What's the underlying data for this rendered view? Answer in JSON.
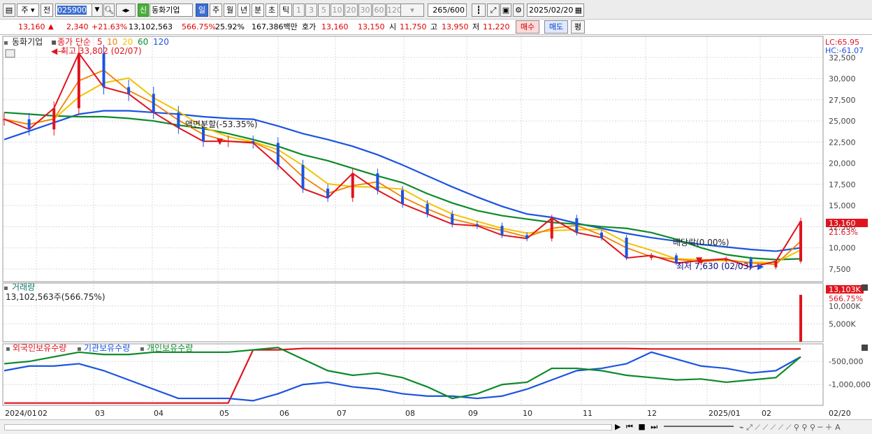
{
  "toolbar": {
    "period_select": "주",
    "jeon_button": "전",
    "code_value": "025900",
    "new_badge": "신",
    "stock_name": "동화기업",
    "period_tabs": [
      "일",
      "주",
      "월",
      "년",
      "분",
      "초",
      "틱"
    ],
    "interval_buttons": [
      "1",
      "3",
      "5",
      "10",
      "20",
      "30",
      "60",
      "120"
    ],
    "count_display": "265",
    "count_total": "/600",
    "date_value": "2025/02/20"
  },
  "quote": {
    "price": "13,160",
    "change": "2,340",
    "change_pct": "+21.63%",
    "volume": "13,102,563",
    "volume_ratio": "566.75%",
    "turnover": "25.92%",
    "amount": "167,386백만",
    "ask_label": "호가",
    "ask_price": "13,160",
    "bid_price": "13,150",
    "open_label": "시",
    "open": "11,750",
    "high_label": "고",
    "high": "13,950",
    "low_label": "저",
    "low": "11,220",
    "buy_button": "매수",
    "sell_button": "매도",
    "eval_button": "평"
  },
  "price_pane": {
    "title": "동화기업",
    "legend_prefix": "종가 단순",
    "ma_periods": [
      "5",
      "10",
      "20",
      "60",
      "120"
    ],
    "ma_colors": [
      "#e0141e",
      "#f18000",
      "#f3c200",
      "#0e8a2a",
      "#1c54e0"
    ],
    "high_note": "최고 33,802 (02/07)",
    "low_note": "최저 7,630 (02/03)",
    "split_note": "액면분할(-53.35%)",
    "dividend_note": "배당락(0.00%)",
    "lc_label": "LC:65.95",
    "hc_label": "HC:-61.07",
    "current_price_label": "13,160",
    "current_pct_label": "21.63%"
  },
  "volume_pane": {
    "title": "거래량",
    "value_text": "13,102,563주(566.75%)",
    "current_label": "13,103K",
    "current_pct": "566.75%",
    "y_ticks": [
      "5,000K",
      "10,000K"
    ]
  },
  "holding_pane": {
    "legend": [
      "외국인보유수량",
      "기관보유수량",
      "개인보유수량"
    ],
    "legend_colors": [
      "#e0141e",
      "#1c54e0",
      "#0e8a2a"
    ],
    "y_ticks": [
      "-500,000",
      "-1,000,000"
    ]
  },
  "x_axis": [
    "2024/01",
    "02",
    "03",
    "04",
    "05",
    "06",
    "07",
    "08",
    "09",
    "10",
    "11",
    "12",
    "2025/01",
    "02"
  ],
  "right_axis_end_label": "02/20",
  "chart_data": {
    "type": "line",
    "title": "동화기업",
    "price_y_ticks": [
      7500,
      10000,
      12500,
      15000,
      17500,
      20000,
      22500,
      25000,
      27500,
      30000,
      32500
    ],
    "ylim": [
      6000,
      35000
    ],
    "price_series": {
      "name": "종가",
      "x": [
        "2024/01/02",
        "2024/01/15",
        "2024/01/26",
        "2024/02/07",
        "2024/02/20",
        "2024/03/05",
        "2024/03/20",
        "2024/04/02",
        "2024/04/16",
        "2024/04/30",
        "2024/05/02",
        "2024/05/15",
        "2024/05/30",
        "2024/06/10",
        "2024/06/20",
        "2024/07/03",
        "2024/07/17",
        "2024/07/31",
        "2024/08/14",
        "2024/08/29",
        "2024/09/12",
        "2024/09/27",
        "2024/10/10",
        "2024/10/24",
        "2024/11/07",
        "2024/11/21",
        "2024/12/05",
        "2024/12/19",
        "2025/01/03",
        "2025/01/17",
        "2025/02/03",
        "2025/02/14",
        "2025/02/20"
      ],
      "values": [
        25200,
        24000,
        26500,
        33000,
        29000,
        28200,
        26000,
        24200,
        22600,
        22600,
        22400,
        19800,
        17000,
        15900,
        18800,
        16800,
        15200,
        14000,
        12800,
        12600,
        11500,
        11100,
        13500,
        11800,
        11200,
        8800,
        9100,
        8200,
        8500,
        8700,
        7700,
        8400,
        13160
      ]
    },
    "ma120_values": [
      22800,
      23800,
      24800,
      25800,
      26200,
      26200,
      26000,
      25800,
      25500,
      25300,
      25200,
      24400,
      23500,
      22800,
      22000,
      21000,
      19800,
      18500,
      17200,
      16000,
      14900,
      14000,
      13600,
      12900,
      12300,
      11700,
      11200,
      10800,
      10400,
      10100,
      9800,
      9600,
      10000
    ],
    "ma60_values": [
      26000,
      25800,
      25600,
      25500,
      25500,
      25300,
      25000,
      24500,
      24100,
      23500,
      22800,
      22000,
      21000,
      20300,
      19400,
      18500,
      17700,
      16400,
      15300,
      14400,
      13800,
      13400,
      13000,
      12800,
      12500,
      12300,
      11800,
      11000,
      10000,
      9200,
      8800,
      8600,
      8700
    ],
    "volume_series": {
      "name": "거래량",
      "peak_value": 13102563,
      "ylim": [
        0,
        16000000
      ]
    },
    "holding_series": [
      {
        "name": "외국인보유수량",
        "values": [
          -1400000,
          -1400000,
          -1400000,
          -1400000,
          -1400000,
          -1400000,
          -1400000,
          -1400000,
          -1400000,
          -1400000,
          -250000,
          -250000,
          -220000,
          -220000,
          -220000,
          -220000,
          -220000,
          -220000,
          -220000,
          -220000,
          -220000,
          -220000,
          -220000,
          -220000,
          -220000,
          -220000,
          -230000,
          -230000,
          -230000,
          -230000,
          -230000,
          -230000,
          -230000
        ]
      },
      {
        "name": "기관보유수량",
        "values": [
          -700000,
          -600000,
          -600000,
          -550000,
          -700000,
          -900000,
          -1100000,
          -1300000,
          -1300000,
          -1300000,
          -1350000,
          -1200000,
          -1000000,
          -950000,
          -1050000,
          -1100000,
          -1200000,
          -1250000,
          -1250000,
          -1300000,
          -1250000,
          -1100000,
          -900000,
          -700000,
          -650000,
          -550000,
          -300000,
          -450000,
          -600000,
          -650000,
          -750000,
          -700000,
          -400000
        ]
      },
      {
        "name": "개인보유수량",
        "values": [
          -550000,
          -500000,
          -400000,
          -300000,
          -350000,
          -350000,
          -300000,
          -300000,
          -300000,
          -300000,
          -250000,
          -200000,
          -450000,
          -700000,
          -800000,
          -750000,
          -850000,
          -1050000,
          -1300000,
          -1200000,
          -1000000,
          -950000,
          -650000,
          -650000,
          -700000,
          -800000,
          -850000,
          -900000,
          -880000,
          -950000,
          -900000,
          -850000,
          -400000
        ]
      }
    ]
  }
}
